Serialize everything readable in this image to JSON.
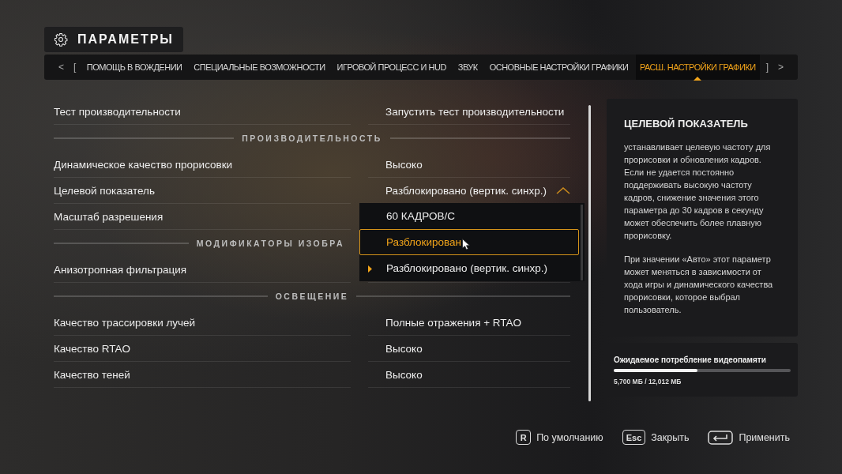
{
  "header": {
    "title": "ПАРАМЕТРЫ"
  },
  "tabs": {
    "prev": "<",
    "bracket_left": "[",
    "bracket_right": "]",
    "next": ">",
    "items": [
      {
        "label": "ПОМОЩЬ В ВОЖДЕНИИ",
        "selected": false
      },
      {
        "label": "СПЕЦИАЛЬНЫЕ ВОЗМОЖНОСТИ",
        "selected": false
      },
      {
        "label": "ИГРОВОЙ ПРОЦЕСС И HUD",
        "selected": false
      },
      {
        "label": "ЗВУК",
        "selected": false
      },
      {
        "label": "ОСНОВНЫЕ НАСТРОЙКИ ГРАФИКИ",
        "selected": false
      },
      {
        "label": "РАСШ. НАСТРОЙКИ ГРАФИКИ",
        "selected": true
      }
    ]
  },
  "settings": [
    {
      "kind": "row",
      "label": "Тест производительности",
      "value": "Запустить тест производительности"
    },
    {
      "kind": "section",
      "label": "ПРОИЗВОДИТЕЛЬНОСТЬ",
      "covered": false
    },
    {
      "kind": "row",
      "label": "Динамическое качество прорисовки",
      "value": "Высоко"
    },
    {
      "kind": "row",
      "label": "Целевой показатель",
      "value": "Разблокировано (вертик. синхр.)",
      "expanded": true,
      "options": [
        {
          "label": "60 КАДРОВ/С",
          "selected": false,
          "focused": false
        },
        {
          "label": "Разблокирован",
          "selected": false,
          "focused": true
        },
        {
          "label": "Разблокировано (вертик. синхр.)",
          "selected": true,
          "focused": false
        }
      ]
    },
    {
      "kind": "row",
      "label": "Масштаб разрешения"
    },
    {
      "kind": "section",
      "label": "МОДИФИКАТОРЫ ИЗОБРА",
      "covered": true
    },
    {
      "kind": "row",
      "label": "Анизотропная фильтрация"
    },
    {
      "kind": "section",
      "label": "ОСВЕЩЕНИЕ",
      "covered": false
    },
    {
      "kind": "row",
      "label": "Качество трассировки лучей",
      "value": "Полные отражения + RTAO"
    },
    {
      "kind": "row",
      "label": "Качество RTAO",
      "value": "Высоко"
    },
    {
      "kind": "row",
      "label": "Качество теней",
      "value": "Высоко"
    }
  ],
  "info": {
    "title": "ЦЕЛЕВОЙ ПОКАЗАТЕЛЬ",
    "paragraphs": [
      "устанавливает целевую частоту для прорисовки и обновления кадров. Если не удается постоянно поддерживать высокую частоту кадров, снижение значения этого параметра до 30 кадров в секунду может обеспечить более плавную прорисовку.",
      "При значении «Авто» этот параметр может меняться в зависимости от хода игры и динамического качества прорисовки, которое выбрал пользователь."
    ]
  },
  "memory": {
    "label": "Ожидаемое потребление видеопамяти",
    "level": 0.475,
    "reading": "5,700 МБ / 12,012 МБ"
  },
  "footer": [
    {
      "kind": "key",
      "key": "R",
      "label": "По умолчанию"
    },
    {
      "kind": "key",
      "key": "Esc",
      "label": "Закрыть"
    },
    {
      "kind": "enter",
      "label": "Применить"
    }
  ]
}
